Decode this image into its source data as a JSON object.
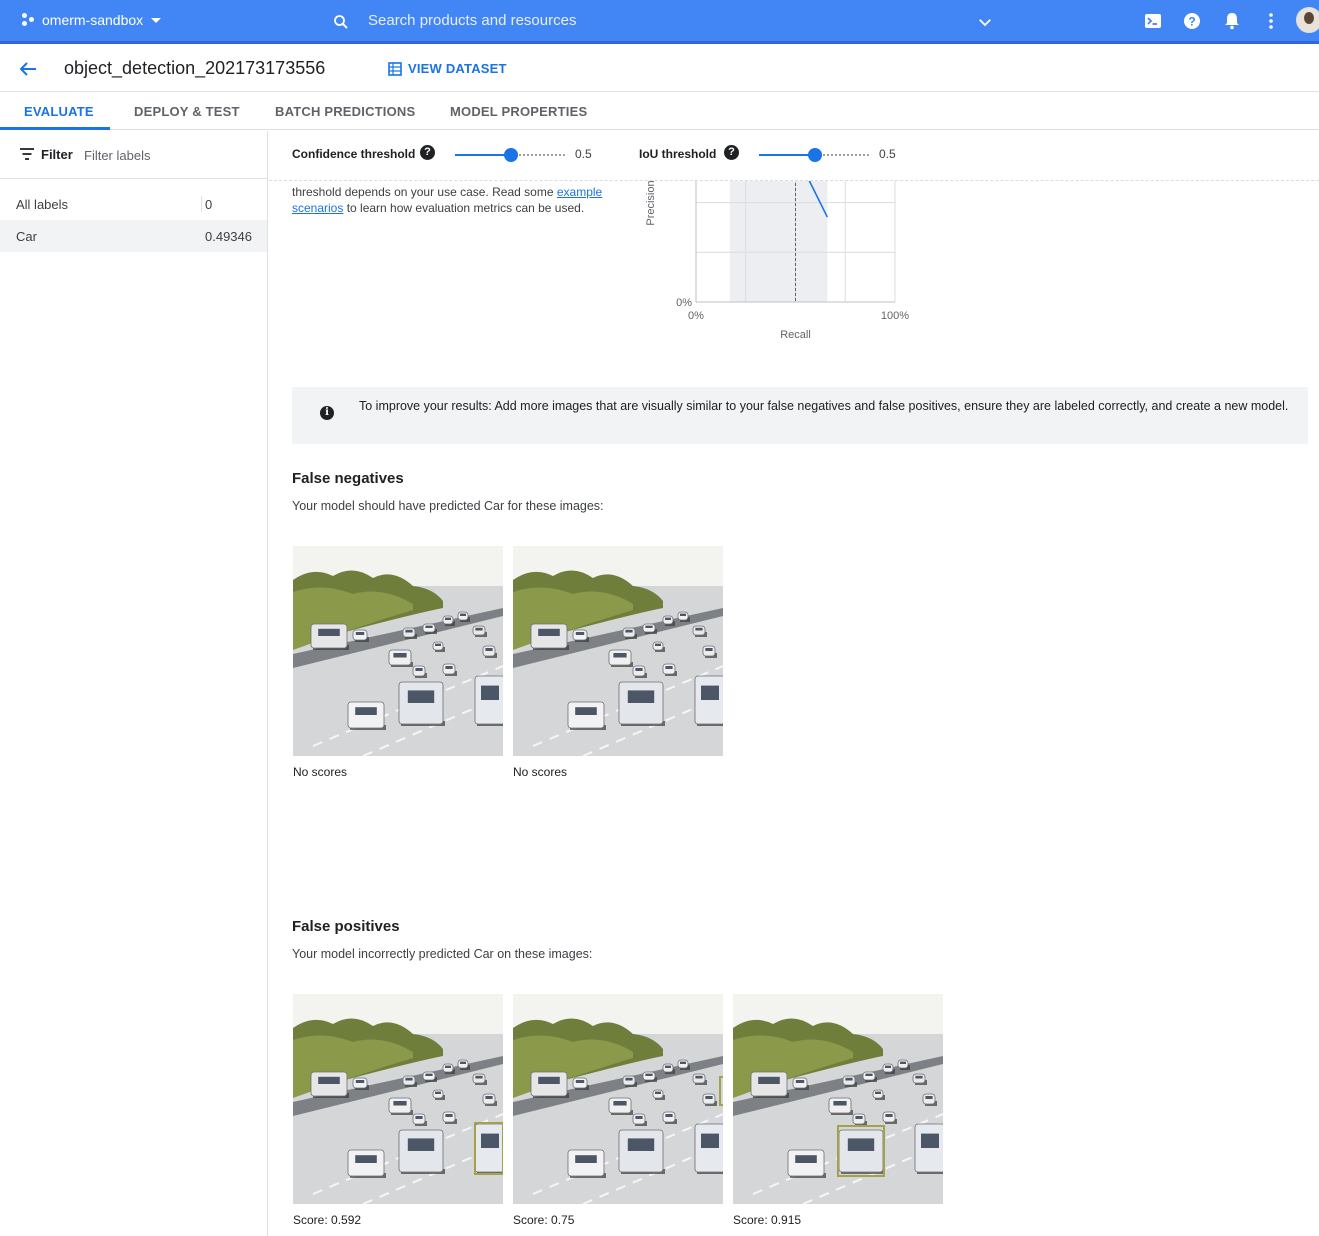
{
  "header": {
    "project": "omerm-sandbox",
    "search_placeholder": "Search products and resources"
  },
  "title_row": {
    "title": "object_detection_202173173556",
    "view_dataset": "VIEW DATASET"
  },
  "tabs": [
    {
      "label": "EVALUATE"
    },
    {
      "label": "DEPLOY & TEST"
    },
    {
      "label": "BATCH PREDICTIONS"
    },
    {
      "label": "MODEL PROPERTIES"
    }
  ],
  "filter": {
    "label": "Filter",
    "placeholder": "Filter labels"
  },
  "labels": [
    {
      "name": "All labels",
      "value": "0"
    },
    {
      "name": "Car",
      "value": "0.49346"
    }
  ],
  "thresholds": {
    "confidence": {
      "label": "Confidence threshold",
      "value": "0.5",
      "fraction": 0.5
    },
    "iou": {
      "label": "IoU threshold",
      "value": "0.5",
      "fraction": 0.5
    }
  },
  "explain": {
    "before": "threshold depends on your use case. Read some ",
    "link1": "example",
    "link2": "scenarios",
    "after": " to learn how evaluation metrics can be used."
  },
  "chart_data": {
    "type": "line",
    "xlabel": "Recall",
    "ylabel": "Precision",
    "x_tick_labels": [
      "0%",
      "100%"
    ],
    "y_tick_labels": [
      "0%"
    ],
    "xlim": [
      0,
      1
    ],
    "ylim": [
      0,
      1
    ],
    "grid": true,
    "series": [
      {
        "x": [
          0.5,
          0.66
        ],
        "y": [
          1.0,
          0.57
        ]
      }
    ],
    "highlight_point": {
      "x": 0.5,
      "y": 1.0
    },
    "shaded_recall_range": [
      0.17,
      0.66
    ]
  },
  "banner": {
    "text": "To improve your results: Add more images that are visually similar to your false negatives and false positives, ensure they are labeled correctly, and create a new model."
  },
  "false_negatives": {
    "title": "False negatives",
    "subtitle": "Your model should have predicted Car for these images:",
    "items": [
      {
        "caption": "No scores"
      },
      {
        "caption": "No scores"
      }
    ]
  },
  "false_positives": {
    "title": "False positives",
    "subtitle": "Your model incorrectly predicted Car on these images:",
    "items": [
      {
        "caption": "Score: 0.592"
      },
      {
        "caption": "Score: 0.75"
      },
      {
        "caption": "Score: 0.915"
      }
    ]
  },
  "colors": {
    "accent": "#1a73e8",
    "header": "#4285f4",
    "bbox": "#a5a04a"
  }
}
